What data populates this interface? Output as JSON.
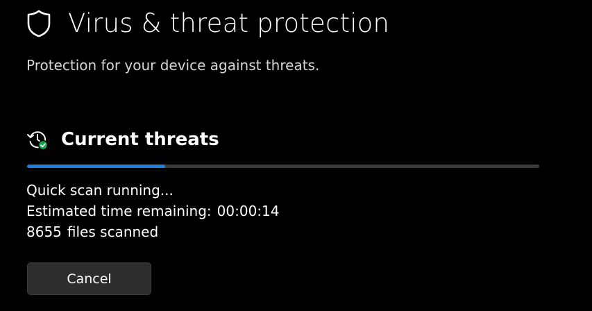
{
  "header": {
    "title": "Virus & threat protection",
    "subtitle": "Protection for your device against threats.",
    "icon": "shield-icon"
  },
  "current_threats": {
    "title": "Current threats",
    "icon": "scan-history-icon",
    "progress_fraction": 0.27,
    "status": "Quick scan running...",
    "time_label": "Estimated time remaining:",
    "time_value": "00:00:14",
    "files_count": "8655",
    "files_label": "files scanned",
    "cancel_label": "Cancel"
  },
  "colors": {
    "background": "#000000",
    "accent": "#1f7fe0",
    "track": "#3a3a3a",
    "button": "#2d2d2d",
    "success_badge": "#16a34a"
  }
}
